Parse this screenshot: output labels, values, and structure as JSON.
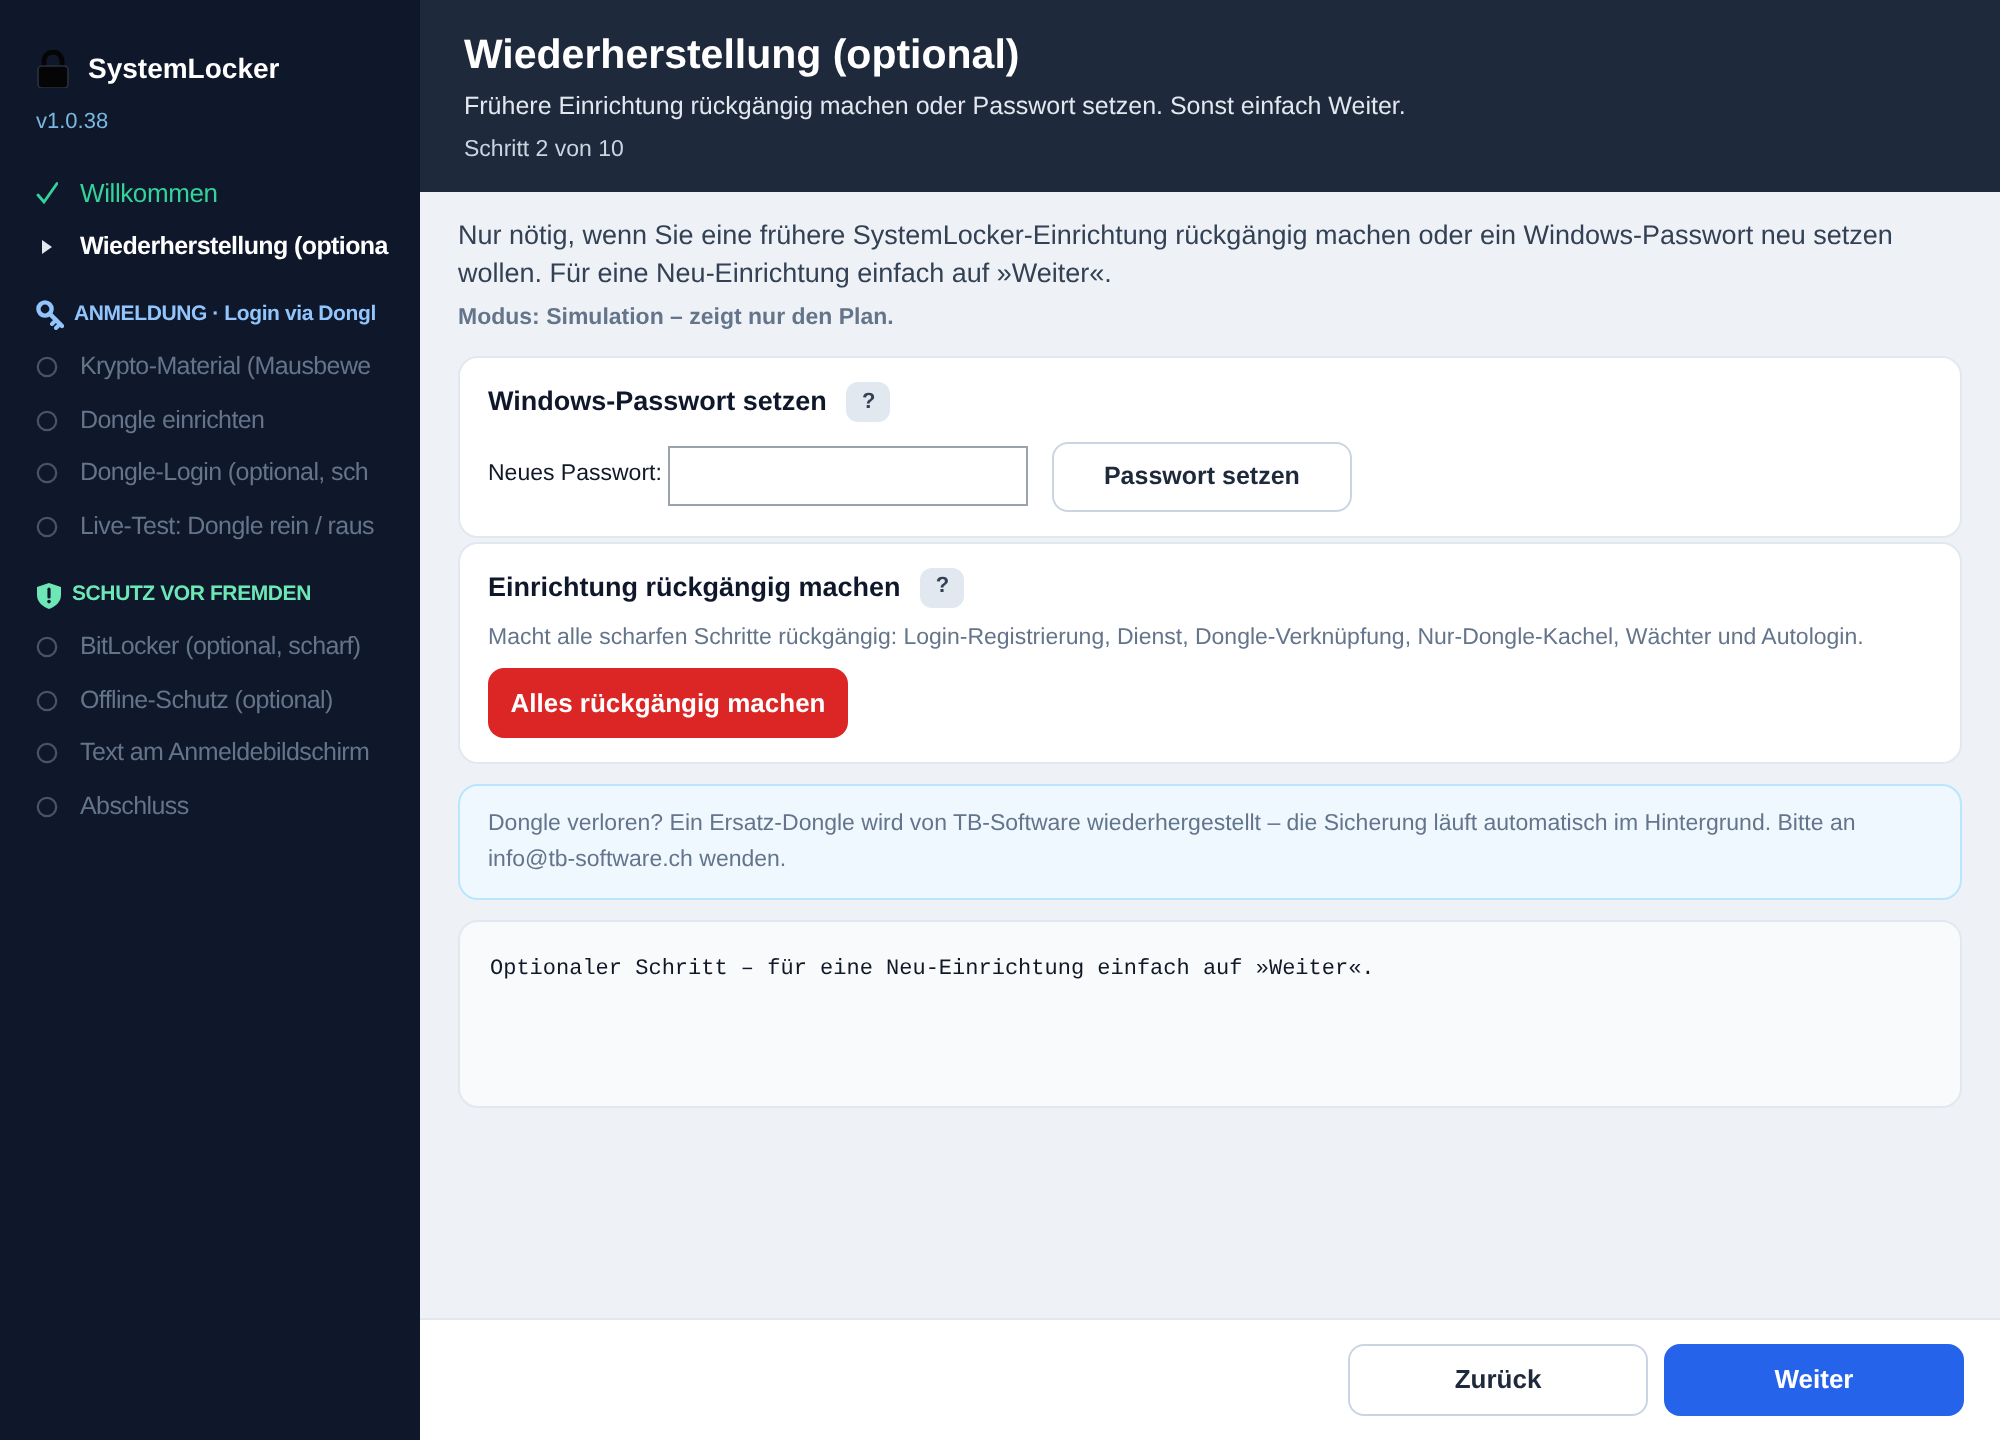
{
  "app": {
    "name": "SystemLocker",
    "version": "v1.0.38"
  },
  "sidebar": {
    "groups": [
      {
        "steps": [
          {
            "label": "Willkommen",
            "completed": true,
            "selected": false
          },
          {
            "label": "Wiederherstellung (optiona",
            "completed": false,
            "selected": true
          }
        ]
      },
      {
        "title": "ANMELDUNG · Login via Dongl",
        "color": "#93c5fd",
        "steps": [
          {
            "label": "Krypto-Material (Mausbewe",
            "completed": false,
            "selected": false
          },
          {
            "label": "Dongle einrichten",
            "completed": false,
            "selected": false
          },
          {
            "label": "Dongle-Login (optional, sch",
            "completed": false,
            "selected": false
          },
          {
            "label": "Live-Test: Dongle rein / raus",
            "completed": false,
            "selected": false
          }
        ]
      },
      {
        "title": "SCHUTZ VOR FREMDEN",
        "color": "#6ee7b7",
        "steps": [
          {
            "label": "BitLocker (optional, scharf)",
            "completed": false,
            "selected": false
          },
          {
            "label": "Offline-Schutz (optional)",
            "completed": false,
            "selected": false
          },
          {
            "label": "Text am Anmeldebildschirm",
            "completed": false,
            "selected": false
          },
          {
            "label": "Abschluss",
            "completed": false,
            "selected": false
          }
        ]
      }
    ]
  },
  "header": {
    "title": "Wiederherstellung (optional)",
    "subtitle": "Frühere Einrichtung rückgängig machen oder Passwort setzen. Sonst einfach Weiter.",
    "step": "Schritt 2 von 10"
  },
  "intro": "Nur nötig, wenn Sie eine frühere SystemLocker-Einrichtung rückgängig machen oder ein Windows-Passwort neu setzen wollen. Für eine Neu-Einrichtung einfach auf »Weiter«.",
  "mode": "Modus: Simulation – zeigt nur den Plan.",
  "cards": [
    {
      "kind": "password",
      "title": "Windows-Passwort setzen",
      "help": "?",
      "field_label": "Neues Passwort:",
      "button": {
        "label": "Passwort setzen",
        "kind": "secondary"
      }
    },
    {
      "kind": "undo",
      "title": "Einrichtung rückgängig machen",
      "help": "?",
      "description": "Macht alle scharfen Schritte rückgängig: Login-Registrierung, Dienst, Dongle-Verknüpfung, Nur-Dongle-Kachel, Wächter und Autologin.",
      "button": {
        "label": "Alles rückgängig machen",
        "kind": "danger"
      }
    }
  ],
  "info": "Dongle verloren? Ein Ersatz-Dongle wird von TB-Software wiederhergestellt – die Sicherung läuft automatisch im Hintergrund. Bitte an info@tb-software.ch wenden.",
  "log": "Optionaler Schritt – für eine Neu-Einrichtung einfach auf »Weiter«.",
  "footer": {
    "buttons": [
      {
        "label": "Zurück",
        "kind": "secondary"
      },
      {
        "label": "Weiter",
        "kind": "primary"
      }
    ]
  }
}
